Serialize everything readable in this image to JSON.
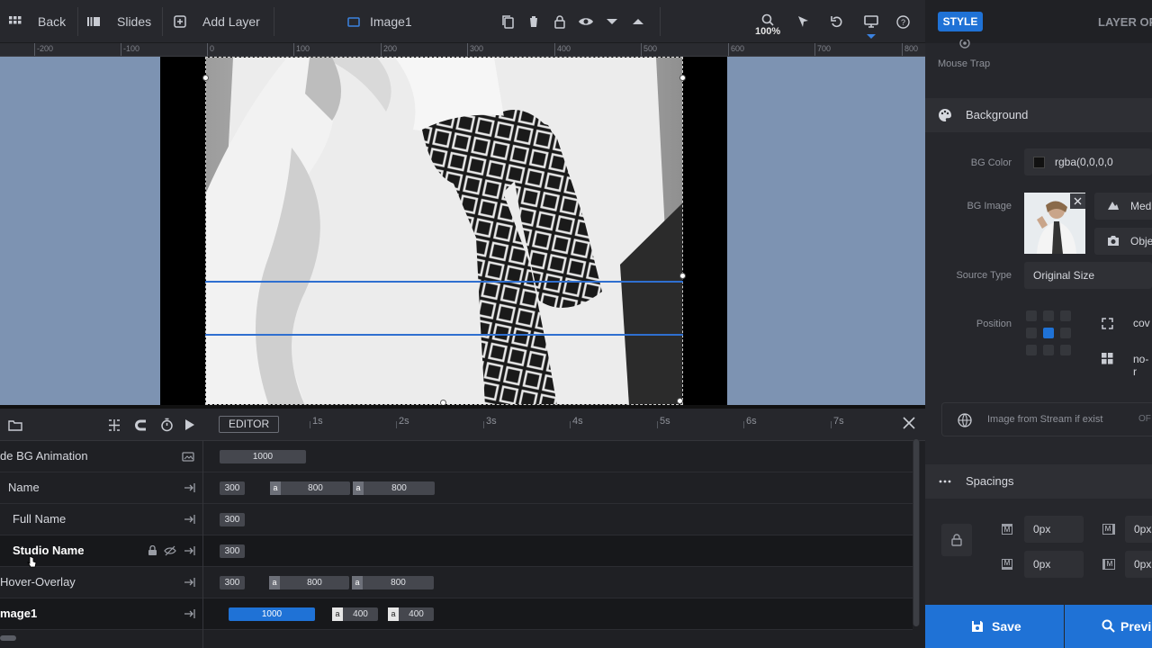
{
  "toolbar": {
    "back_label": "Back",
    "slides_label": "Slides",
    "add_layer_label": "Add Layer",
    "layer_name": "Image1",
    "zoom": "100%"
  },
  "ruler": {
    "labels": [
      "-200",
      "-100",
      "0",
      "100",
      "200",
      "300",
      "400",
      "500",
      "600",
      "700",
      "800"
    ]
  },
  "timeline": {
    "editor_label": "EDITOR",
    "seconds": [
      "1s",
      "2s",
      "3s",
      "4s",
      "5s",
      "6s",
      "7s"
    ],
    "rows": [
      {
        "name": "de BG Animation",
        "b1": "1000"
      },
      {
        "name": "Name",
        "b1": "300",
        "b2": "800",
        "b3": "800"
      },
      {
        "name": "Full Name",
        "b1": "300"
      },
      {
        "name": "Studio Name",
        "b1": "300"
      },
      {
        "name": "Hover-Overlay",
        "b1": "300",
        "b2": "800",
        "b3": "800"
      },
      {
        "name": "mage1",
        "b1": "1000",
        "b2": "400",
        "b3": "400"
      }
    ],
    "a_label": "a"
  },
  "panel": {
    "style_tab": "STYLE",
    "layer_tab": "LAYER OP",
    "mouse_trap": "Mouse Trap",
    "background_title": "Background",
    "bg_color_label": "BG Color",
    "bg_color_value": "rgba(0,0,0,0",
    "bg_image_label": "BG Image",
    "media_btn": "Med",
    "object_btn": "Obje",
    "source_type_label": "Source Type",
    "source_type_value": "Original Size",
    "position_label": "Position",
    "size_value": "cov",
    "repeat_value": "no-r",
    "stream_label": "Image from Stream if exist",
    "stream_toggle": "OF",
    "spacings_title": "Spacings",
    "margin_values": [
      "0px",
      "0px",
      "0px",
      "0px"
    ],
    "m_label": "M",
    "save_label": "Save",
    "preview_label": "Previ"
  },
  "colors": {
    "accent": "#1f72d6",
    "canvas_bg": "#7d93b2",
    "guide": "#2f6fd0"
  }
}
